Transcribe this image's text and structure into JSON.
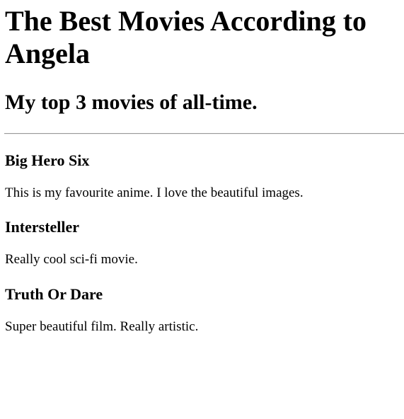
{
  "page": {
    "title": "The Best Movies According to Angela",
    "subtitle": "My top 3 movies of all-time."
  },
  "movies": [
    {
      "title": "Big Hero Six",
      "description": "This is my favourite anime. I love the beautiful images."
    },
    {
      "title": "Intersteller",
      "description": "Really cool sci-fi movie."
    },
    {
      "title": "Truth Or Dare",
      "description": "Super beautiful film. Really artistic."
    }
  ]
}
